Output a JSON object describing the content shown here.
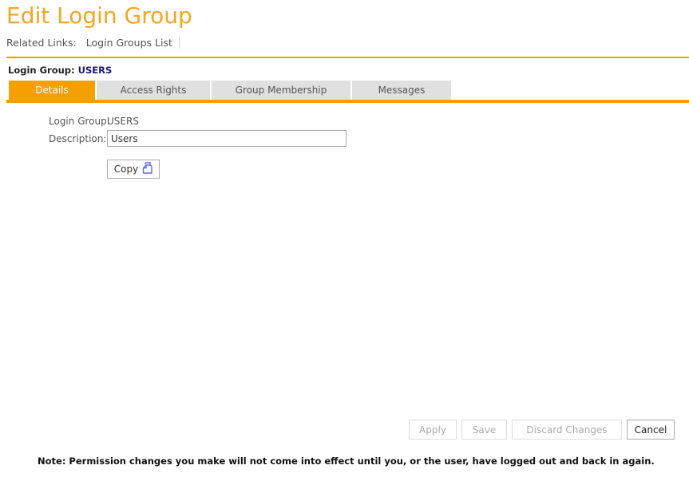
{
  "header": {
    "title": "Edit Login Group",
    "related_links_label": "Related Links:",
    "related_links": [
      {
        "label": "Login Groups List"
      }
    ]
  },
  "context": {
    "label": "Login Group:",
    "value": "USERS"
  },
  "tabs": [
    {
      "label": "Details",
      "active": true
    },
    {
      "label": "Access Rights",
      "active": false
    },
    {
      "label": "Group Membership",
      "active": false
    },
    {
      "label": "Messages",
      "active": false
    }
  ],
  "form": {
    "login_group_label": "Login Group:",
    "login_group_value": "USERS",
    "description_label": "Description:",
    "description_value": "Users",
    "copy_label": "Copy",
    "copy_icon": "copy-icon"
  },
  "actions": {
    "apply": "Apply",
    "save": "Save",
    "discard": "Discard Changes",
    "cancel": "Cancel"
  },
  "note": "Note: Permission changes you make will not come into effect until you, or the user, have logged out and back in again.",
  "colors": {
    "accent": "#f5a000",
    "title": "#f5a623",
    "group_value": "#1a1a6e",
    "tab_inactive": "#e0e0e0",
    "copy_icon": "#5b6ee1"
  }
}
